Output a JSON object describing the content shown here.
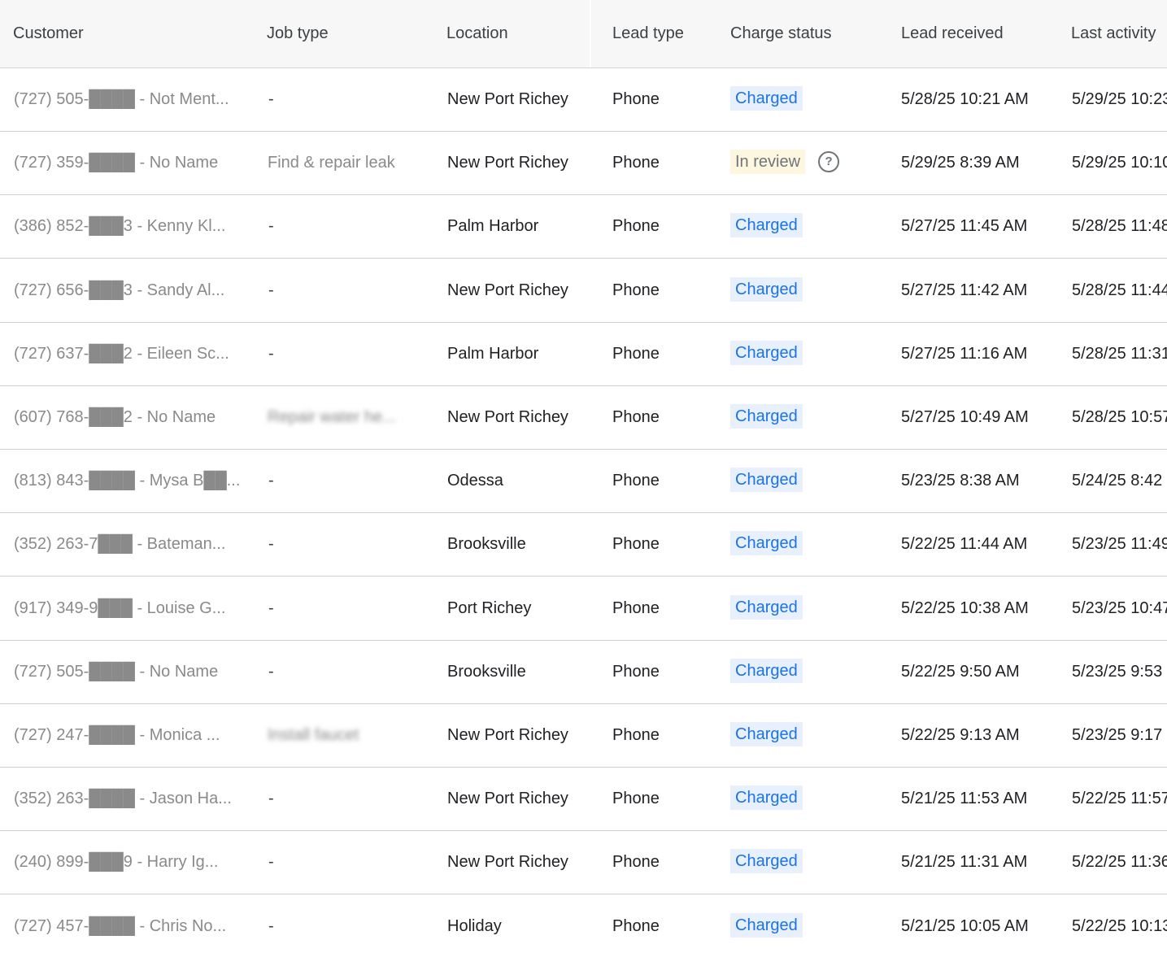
{
  "columns": {
    "customer": "Customer",
    "job_type": "Job type",
    "location": "Location",
    "lead_type": "Lead type",
    "charge_status": "Charge status",
    "lead_received": "Lead received",
    "last_activity": "Last activity"
  },
  "rows": [
    {
      "customer": "(727) 505-████ - Not Ment...",
      "job_type": "-",
      "location": "New Port Richey",
      "lead_type": "Phone",
      "charge_status": "Charged",
      "lead_received": "5/28/25 10:21 AM",
      "last_activity": "5/29/25 10:23"
    },
    {
      "customer": "(727) 359-████ - No Name",
      "job_type": "Find & repair leak",
      "location": "New Port Richey",
      "lead_type": "Phone",
      "charge_status": "In review",
      "lead_received": "5/29/25 8:39 AM",
      "last_activity": "5/29/25 10:10"
    },
    {
      "customer": "(386) 852-███3 - Kenny Kl...",
      "job_type": "-",
      "location": "Palm Harbor",
      "lead_type": "Phone",
      "charge_status": "Charged",
      "lead_received": "5/27/25 11:45 AM",
      "last_activity": "5/28/25 11:48"
    },
    {
      "customer": "(727) 656-███3 - Sandy Al...",
      "job_type": "-",
      "location": "New Port Richey",
      "lead_type": "Phone",
      "charge_status": "Charged",
      "lead_received": "5/27/25 11:42 AM",
      "last_activity": "5/28/25 11:44"
    },
    {
      "customer": "(727) 637-███2 - Eileen Sc...",
      "job_type": "-",
      "location": "Palm Harbor",
      "lead_type": "Phone",
      "charge_status": "Charged",
      "lead_received": "5/27/25 11:16 AM",
      "last_activity": "5/28/25 11:31"
    },
    {
      "customer": "(607) 768-███2 - No Name",
      "job_type": "Repair water he...",
      "location": "New Port Richey",
      "lead_type": "Phone",
      "charge_status": "Charged",
      "lead_received": "5/27/25 10:49 AM",
      "last_activity": "5/28/25 10:57"
    },
    {
      "customer": "(813) 843-████ - Mysa B██...",
      "job_type": "-",
      "location": "Odessa",
      "lead_type": "Phone",
      "charge_status": "Charged",
      "lead_received": "5/23/25 8:38 AM",
      "last_activity": "5/24/25 8:42"
    },
    {
      "customer": "(352) 263-7███ - Bateman...",
      "job_type": "-",
      "location": "Brooksville",
      "lead_type": "Phone",
      "charge_status": "Charged",
      "lead_received": "5/22/25 11:44 AM",
      "last_activity": "5/23/25 11:49"
    },
    {
      "customer": "(917) 349-9███ - Louise G...",
      "job_type": "-",
      "location": "Port Richey",
      "lead_type": "Phone",
      "charge_status": "Charged",
      "lead_received": "5/22/25 10:38 AM",
      "last_activity": "5/23/25 10:47"
    },
    {
      "customer": "(727) 505-████ - No Name",
      "job_type": "-",
      "location": "Brooksville",
      "lead_type": "Phone",
      "charge_status": "Charged",
      "lead_received": "5/22/25 9:50 AM",
      "last_activity": "5/23/25 9:53"
    },
    {
      "customer": "(727) 247-████ - Monica ...",
      "job_type": "Install faucet",
      "location": "New Port Richey",
      "lead_type": "Phone",
      "charge_status": "Charged",
      "lead_received": "5/22/25 9:13 AM",
      "last_activity": "5/23/25 9:17"
    },
    {
      "customer": "(352) 263-████ - Jason Ha...",
      "job_type": "-",
      "location": "New Port Richey",
      "lead_type": "Phone",
      "charge_status": "Charged",
      "lead_received": "5/21/25 11:53 AM",
      "last_activity": "5/22/25 11:57"
    },
    {
      "customer": "(240) 899-███9 - Harry Ig...",
      "job_type": "-",
      "location": "New Port Richey",
      "lead_type": "Phone",
      "charge_status": "Charged",
      "lead_received": "5/21/25 11:31 AM",
      "last_activity": "5/22/25 11:36"
    },
    {
      "customer": "(727) 457-████ - Chris No...",
      "job_type": "-",
      "location": "Holiday",
      "lead_type": "Phone",
      "charge_status": "Charged",
      "lead_received": "5/21/25 10:05 AM",
      "last_activity": "5/22/25 10:13"
    }
  ],
  "colors": {
    "charged_text": "#1a73e8",
    "charged_bg": "#e8f0fe",
    "review_bg": "#fef7e0",
    "header_bg": "#f7f7f7"
  },
  "icons": {
    "help": "question-circle-icon"
  }
}
